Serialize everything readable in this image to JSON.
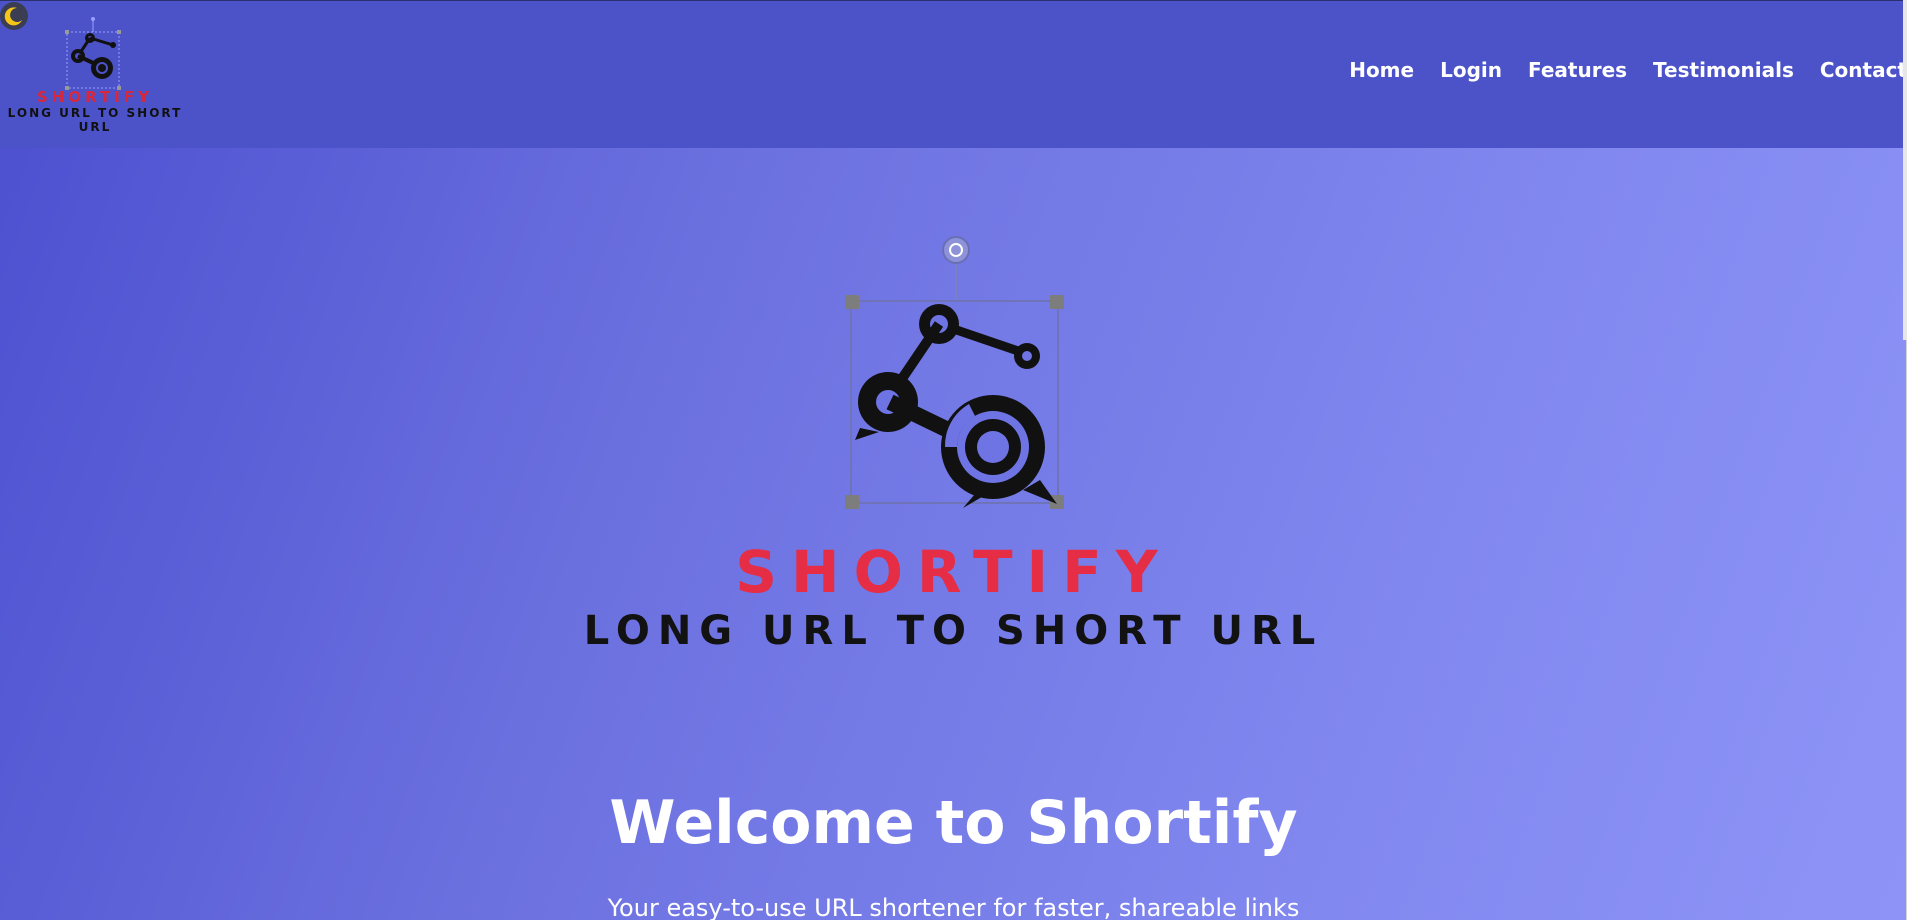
{
  "header": {
    "logo": {
      "brand": "SHORTIFY",
      "tagline": "LONG URL TO SHORT URL",
      "icon": "link-network-icon"
    },
    "theme_toggle": {
      "icon": "moon-icon"
    },
    "nav": [
      {
        "label": "Home"
      },
      {
        "label": "Login"
      },
      {
        "label": "Features"
      },
      {
        "label": "Testimonials"
      },
      {
        "label": "Contact"
      }
    ]
  },
  "hero": {
    "brand": "SHORTIFY",
    "tagline": "LONG URL TO SHORT URL",
    "title": "Welcome to Shortify",
    "subtitle": "Your easy-to-use URL shortener for faster, shareable links",
    "logo_icon": "link-network-icon",
    "selection_handles": "image-resize-handles"
  },
  "colors": {
    "header_bg": "#4c53c9",
    "brand_red": "#e52d45",
    "text_white": "#ffffff",
    "text_dark": "#121212"
  }
}
